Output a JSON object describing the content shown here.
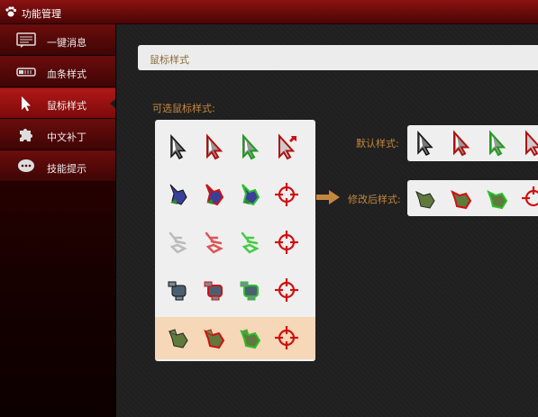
{
  "window": {
    "title": "功能管理",
    "logo_icon": "paw-icon"
  },
  "sidebar": {
    "items": [
      {
        "label": "一键消息",
        "icon": "message-icon",
        "active": false
      },
      {
        "label": "血条样式",
        "icon": "health-bar-icon",
        "active": false
      },
      {
        "label": "鼠标样式",
        "icon": "cursor-icon",
        "active": true
      },
      {
        "label": "中文补丁",
        "icon": "puzzle-icon",
        "active": false
      },
      {
        "label": "技能提示",
        "icon": "tip-bubble-icon",
        "active": false
      }
    ]
  },
  "main": {
    "heading": "鼠标样式",
    "available_label": "可选鼠标样式:",
    "cursor_grid": [
      [
        "arrow-cursor-default",
        "arrow-cursor-red",
        "arrow-cursor-green",
        "arrow-cursor-attack"
      ],
      [
        "blue-gauntlet-default",
        "blue-gauntlet-red",
        "blue-gauntlet-green",
        "crosshair-target"
      ],
      [
        "skeleton-hand-default",
        "skeleton-hand-red",
        "skeleton-hand-green",
        "crosshair-target"
      ],
      [
        "mech-hand-default",
        "mech-hand-red",
        "mech-hand-green",
        "crosshair-target"
      ],
      [
        "orc-hand-default",
        "orc-hand-red",
        "orc-hand-green",
        "crosshair-target"
      ]
    ],
    "selected_row": 4,
    "default_style_label": "默认样式:",
    "modified_style_label": "修改后样式:",
    "default_preview": [
      "arrow-cursor-default",
      "arrow-cursor-red",
      "arrow-cursor-green",
      "arrow-cursor-attack"
    ],
    "modified_preview": [
      "orc-hand-default",
      "orc-hand-red",
      "orc-hand-green",
      "crosshair-target"
    ]
  },
  "colors": {
    "accent": "#c4873f",
    "titlebar": "#8c1212",
    "highlight": "#f6d7b7"
  }
}
